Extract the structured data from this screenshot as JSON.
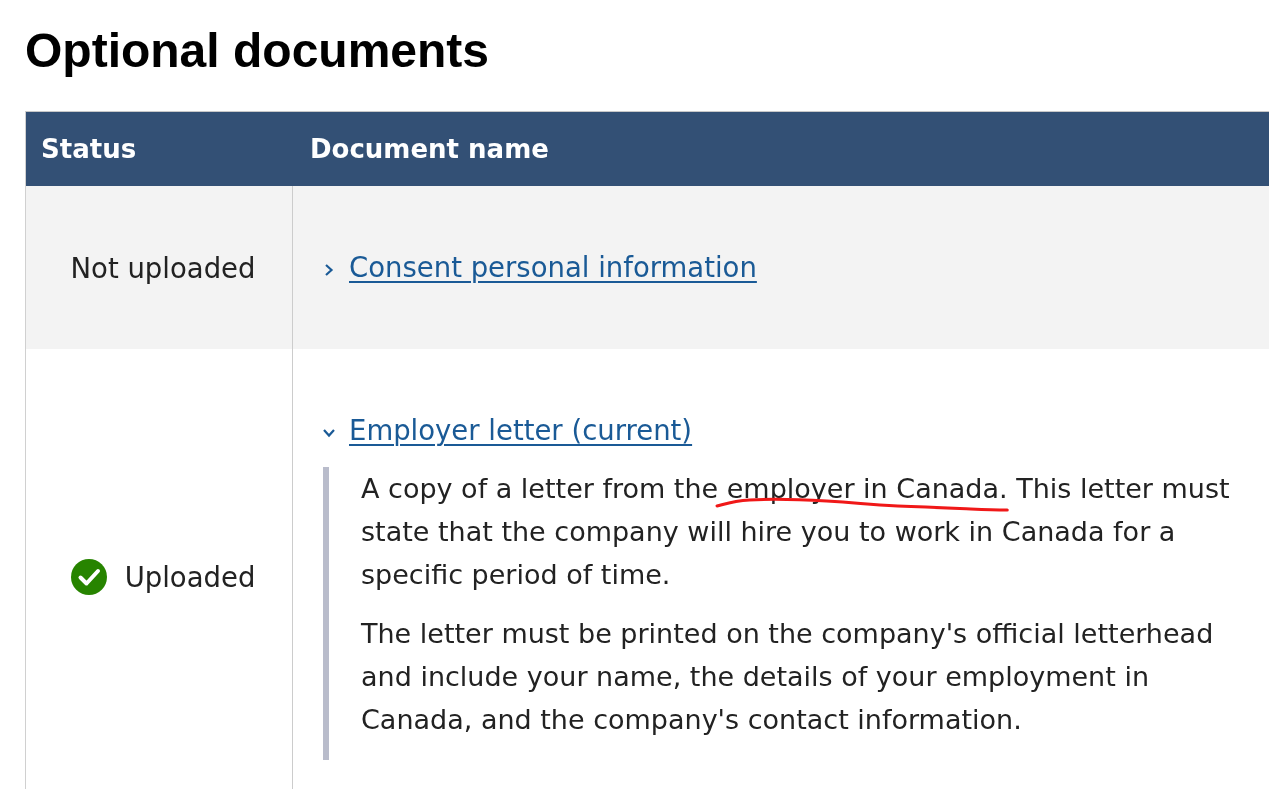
{
  "page": {
    "title": "Optional documents"
  },
  "table": {
    "columns": [
      "Status",
      "Document name"
    ],
    "rows": [
      {
        "status": {
          "label": "Not uploaded",
          "kind": "pending"
        },
        "document": {
          "name": "Consent personal information",
          "expanded": false
        }
      },
      {
        "status": {
          "label": "Uploaded",
          "kind": "uploaded"
        },
        "document": {
          "name": "Employer letter (current)",
          "expanded": true,
          "details": [
            {
              "segments": [
                {
                  "text": "A copy of a letter from the ",
                  "marked": false
                },
                {
                  "text": "employer in Canada",
                  "marked": true
                },
                {
                  "text": ". This letter must state that the company will hire you to work in Canada for a specific period of time.",
                  "marked": false
                }
              ]
            },
            {
              "segments": [
                {
                  "text": "The letter must be printed on the company's official letterhead and include your name, the details of your employment in Canada, and the company's contact information.",
                  "marked": false
                }
              ]
            }
          ]
        }
      }
    ]
  }
}
